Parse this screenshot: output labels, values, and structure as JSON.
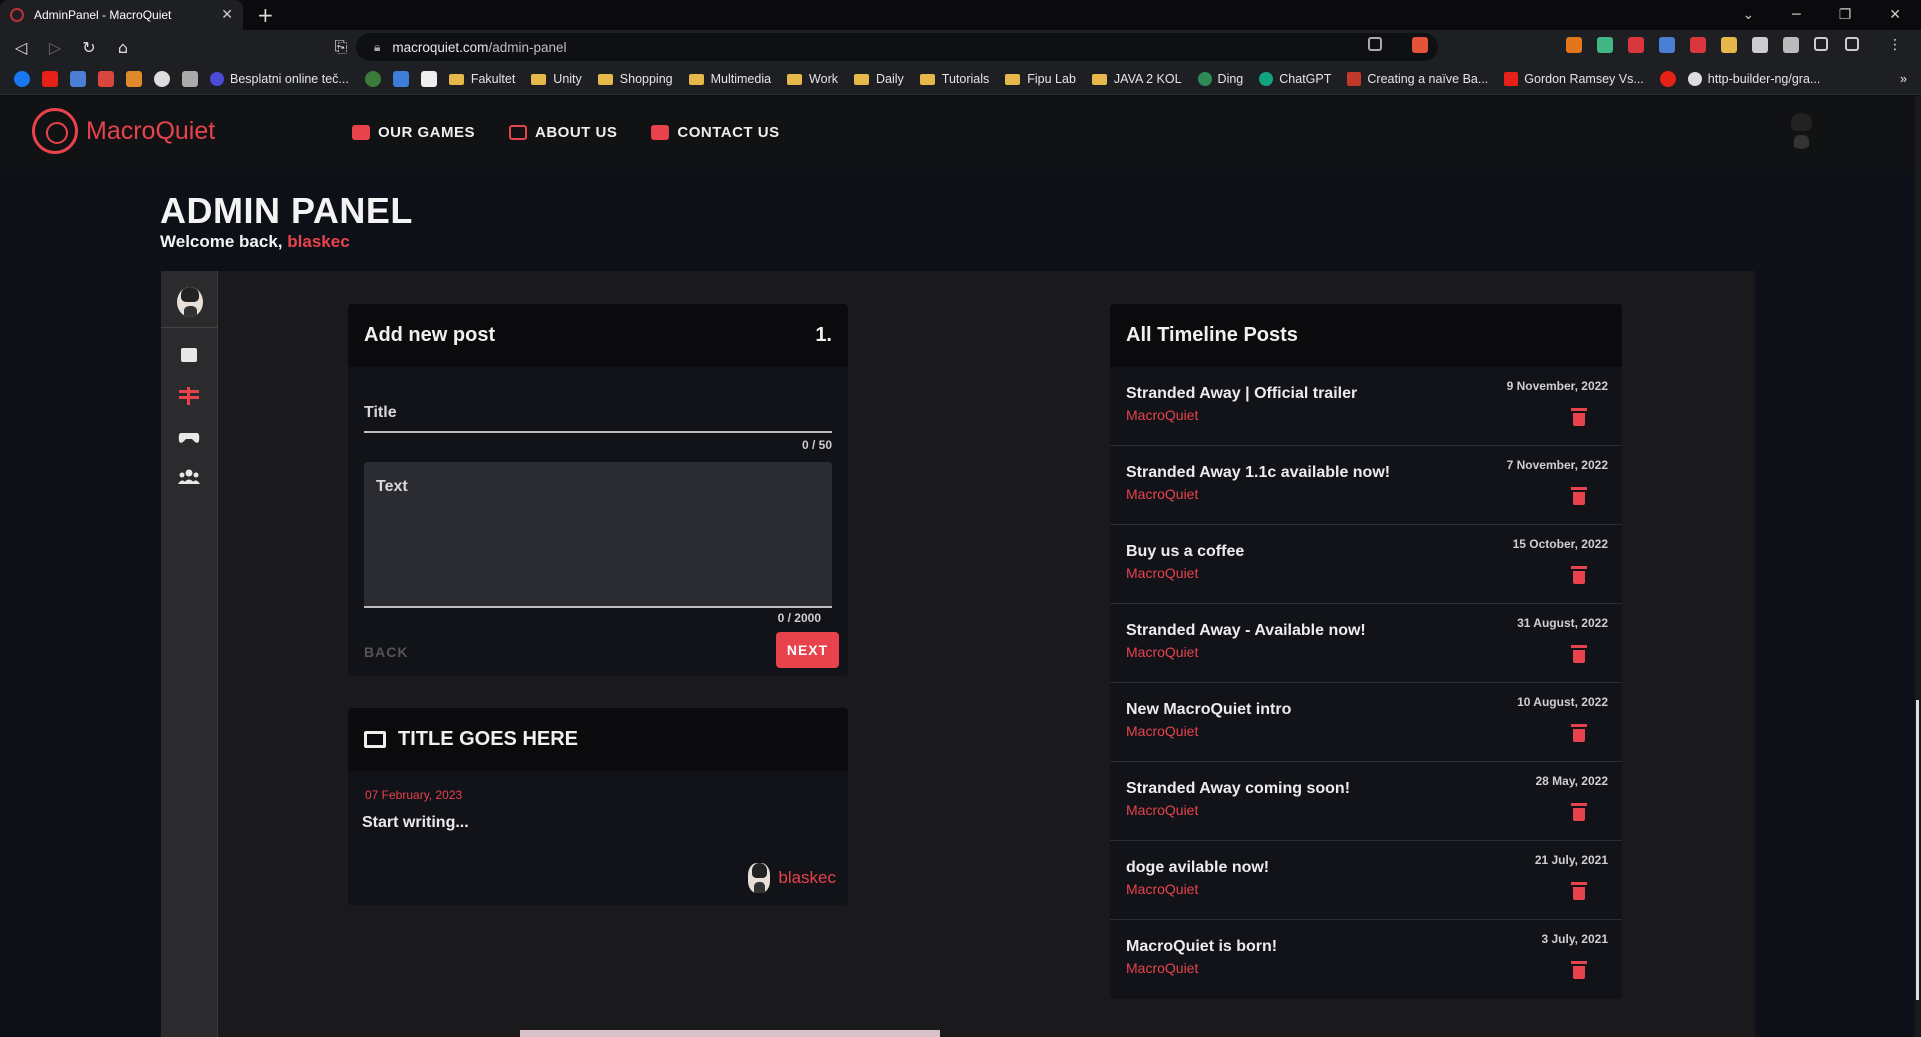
{
  "browser": {
    "tab_title": "AdminPanel - MacroQuiet",
    "url_domain": "macroquiet.com",
    "url_path": "/admin-panel",
    "bookmarks": [
      "Besplatni online teč...",
      "Fakultet",
      "Unity",
      "Shopping",
      "Multimedia",
      "Work",
      "Daily",
      "Tutorials",
      "Fipu Lab",
      "JAVA 2 KOL",
      "Ding",
      "ChatGPT",
      "Creating a naïve Ba...",
      "Gordon Ramsey Vs...",
      "http-builder-ng/gra..."
    ]
  },
  "site": {
    "brand": "MacroQuiet",
    "nav": [
      "OUR GAMES",
      "ABOUT US",
      "CONTACT US"
    ],
    "accent_color": "#e8424d"
  },
  "page": {
    "title": "ADMIN PANEL",
    "welcome_prefix": "Welcome back,",
    "username": "blaskec"
  },
  "add_post": {
    "heading": "Add new post",
    "step": "1.",
    "title_label": "Title",
    "title_counter": "0 / 50",
    "text_placeholder": "Text",
    "text_counter": "0 / 2000",
    "back_label": "BACK",
    "next_label": "NEXT"
  },
  "preview": {
    "title": "TITLE GOES HERE",
    "date": "07 February, 2023",
    "body": "Start writing...",
    "author": "blaskec"
  },
  "timeline": {
    "heading": "All Timeline Posts",
    "posts": [
      {
        "title": "Stranded Away | Official trailer",
        "author": "MacroQuiet",
        "date": "9 November, 2022"
      },
      {
        "title": "Stranded Away 1.1c available now!",
        "author": "MacroQuiet",
        "date": "7 November, 2022"
      },
      {
        "title": "Buy us a coffee",
        "author": "MacroQuiet",
        "date": "15 October, 2022"
      },
      {
        "title": "Stranded Away - Available now!",
        "author": "MacroQuiet",
        "date": "31 August, 2022"
      },
      {
        "title": "New MacroQuiet intro",
        "author": "MacroQuiet",
        "date": "10 August, 2022"
      },
      {
        "title": "Stranded Away coming soon!",
        "author": "MacroQuiet",
        "date": "28 May, 2022"
      },
      {
        "title": "doge avilable now!",
        "author": "MacroQuiet",
        "date": "21 July, 2021"
      },
      {
        "title": "MacroQuiet is born!",
        "author": "MacroQuiet",
        "date": "3 July, 2021"
      }
    ]
  }
}
